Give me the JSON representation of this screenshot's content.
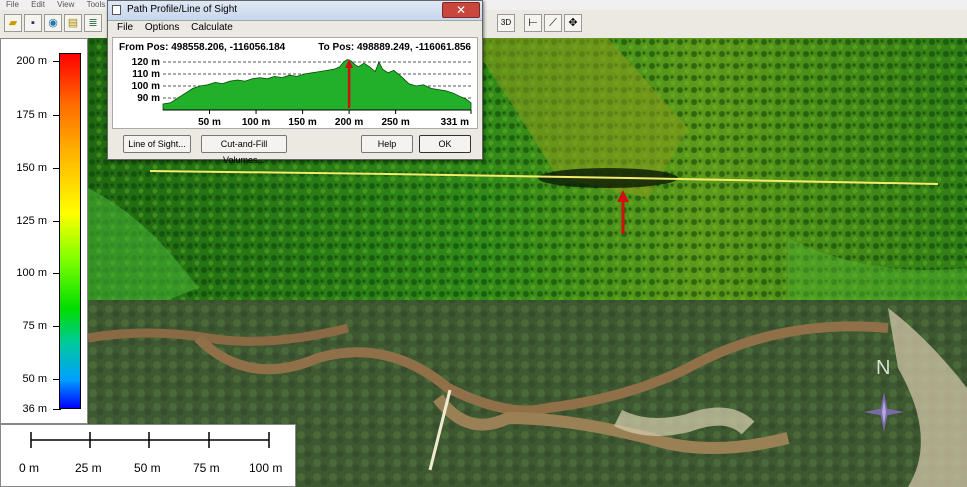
{
  "app": {
    "menu": [
      "File",
      "Edit",
      "View",
      "Tools"
    ]
  },
  "dialog": {
    "title": "Path Profile/Line of Sight",
    "menu": [
      "File",
      "Options",
      "Calculate"
    ],
    "from_pos_label": "From Pos: 498558.206, -116056.184",
    "to_pos_label": "To Pos: 498889.249, -116061.856",
    "buttons": {
      "line_of_sight": "Line of Sight...",
      "cut_fill": "Cut-and-Fill Volumes...",
      "help": "Help",
      "ok": "OK"
    },
    "close_glyph": "✕"
  },
  "chart_data": {
    "type": "area",
    "title": "",
    "xlabel": "",
    "ylabel": "",
    "x_ticks": [
      "50 m",
      "100 m",
      "150 m",
      "200 m",
      "250 m",
      "331 m"
    ],
    "y_ticks": [
      "120 m",
      "110 m",
      "100 m",
      "90 m"
    ],
    "xlim": [
      0,
      331
    ],
    "ylim": [
      80,
      125
    ],
    "series": [
      {
        "x": [
          0,
          8,
          16,
          24,
          32,
          40,
          48,
          56,
          64,
          72,
          80,
          88,
          96,
          104,
          112,
          120,
          128,
          136,
          144,
          152,
          160,
          168,
          176,
          184,
          190,
          194,
          198,
          202,
          206,
          210,
          216,
          222,
          228,
          232,
          236,
          242,
          248,
          256,
          264,
          272,
          280,
          288,
          296,
          304,
          312,
          320,
          326,
          331
        ],
        "y": [
          85,
          86,
          90,
          94,
          98,
          100,
          101,
          103,
          102,
          104,
          105,
          104,
          106,
          107,
          106,
          108,
          107,
          109,
          108,
          110,
          111,
          112,
          113,
          114,
          116,
          120,
          122,
          121,
          118,
          116,
          119,
          116,
          112,
          120,
          114,
          111,
          113,
          108,
          102,
          100,
          101,
          98,
          97,
          96,
          94,
          91,
          89,
          86
        ]
      }
    ],
    "colors": {
      "fill": "#22b02a",
      "line": "#0a4a0a",
      "marker": "#d01010"
    },
    "marker_x": 200,
    "grid": true
  },
  "legend": {
    "ticks": [
      "200 m",
      "175 m",
      "150 m",
      "125 m",
      "100 m",
      "75 m",
      "50 m",
      "36 m"
    ]
  },
  "scale_bar": {
    "labels": [
      "0 m",
      "25 m",
      "50 m",
      "75 m",
      "100 m"
    ]
  },
  "compass": {
    "north": "N"
  }
}
